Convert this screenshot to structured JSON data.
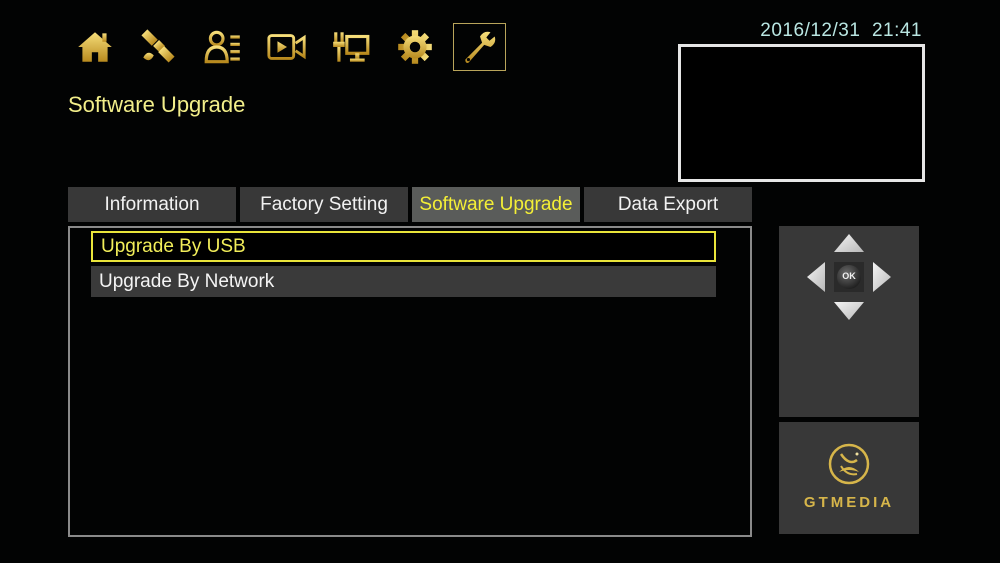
{
  "header": {
    "title": "Software Upgrade",
    "datetime": "2016/12/31  21:41"
  },
  "top_menu": {
    "items": [
      {
        "name": "home",
        "icon": "home-icon"
      },
      {
        "name": "satellite",
        "icon": "satellite-icon"
      },
      {
        "name": "user-list",
        "icon": "user-list-icon"
      },
      {
        "name": "media",
        "icon": "video-camera-icon"
      },
      {
        "name": "network",
        "icon": "network-icon"
      },
      {
        "name": "settings",
        "icon": "gear-icon"
      },
      {
        "name": "tools",
        "icon": "wrench-icon",
        "active": true
      }
    ]
  },
  "tabs": [
    {
      "label": "Information",
      "active": false
    },
    {
      "label": "Factory Setting",
      "active": false
    },
    {
      "label": "Software Upgrade",
      "active": true
    },
    {
      "label": "Data Export",
      "active": false
    }
  ],
  "list": {
    "items": [
      {
        "label": "Upgrade By USB",
        "selected": true
      },
      {
        "label": "Upgrade By Network",
        "selected": false
      }
    ]
  },
  "nav_pad": {
    "ok_label": "OK"
  },
  "brand": {
    "name": "GTMEDIA"
  },
  "colors": {
    "accent_yellow": "#f4ef36",
    "title_yellow": "#f2ee8a",
    "gold_icon": "#d6b54a",
    "datetime": "#b9e6e2",
    "panel_bg": "#383838"
  }
}
